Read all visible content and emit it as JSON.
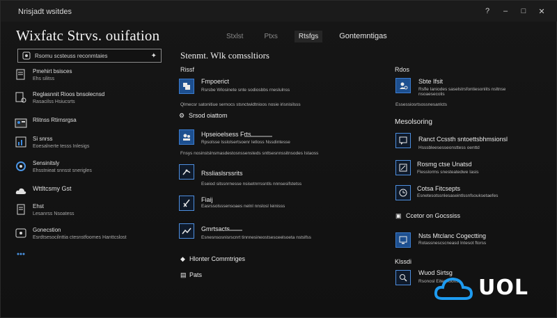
{
  "window": {
    "app_title": "Nrisjadt wsitdes",
    "controls": [
      "?",
      "–",
      "□",
      "✕"
    ]
  },
  "page_title": "Wixfatc Strvs. ouifation",
  "tabs": [
    {
      "label": "Stxlst",
      "state": "normal"
    },
    {
      "label": "Ptxs",
      "state": "normal"
    },
    {
      "label": "Rtsfgs",
      "state": "active"
    },
    {
      "label": "Gontemntigas",
      "state": "emph"
    }
  ],
  "search": {
    "value": "Rsomu scsteuss reconmtaies"
  },
  "sidebar": [
    {
      "icon": "document-icon",
      "title": "Pmehirt bsisces",
      "sub": "Ehs silitss"
    },
    {
      "icon": "doc-settings-icon",
      "title": "Reglasnnit Rioos bnsolecnsd",
      "sub": "Rasacilss Hsiucsrts"
    },
    {
      "icon": "person-card-icon",
      "title": "Rlitnss Rtirnsrgsa",
      "sub": ""
    },
    {
      "icon": "chart-doc-icon",
      "title": "Si snrss",
      "sub": "Eoesalnerte tesss Inlesigs"
    },
    {
      "icon": "refresh-icon",
      "title": "Sensinitsly",
      "sub": "Ehsstnieat snnsst snerigles"
    },
    {
      "icon": "cloud-icon",
      "title": "Wttltcsmy Gst",
      "sub": ""
    },
    {
      "icon": "list-icon",
      "title": "Ehst",
      "sub": "Lesanrss Nsoatess"
    },
    {
      "icon": "info-icon",
      "title": "Gonecstion",
      "sub": "Esrdtsesocilnttia ctesnstfoomes Hanttcslost"
    },
    {
      "icon": "dots-icon",
      "title": "",
      "sub": ""
    }
  ],
  "center": {
    "title": "Stenmt. Wlk comssltiors",
    "section_head": "Rissf",
    "items": [
      {
        "icon": "puzzle-icon",
        "title": "Fmpoerict",
        "desc": "Rsrsbe Wlosinete snte sodiosbbs rneslulnss",
        "tile": "blue"
      },
      {
        "icon": "",
        "title": "Qlmecsr satonitiue sernocs stsnctwidtnioos nosie irisnisilsss",
        "desc": "",
        "tile": "none"
      },
      {
        "icon": "link-icon",
        "title": "Srsod oiattom",
        "desc": "",
        "tile": "none"
      },
      {
        "icon": "people-icon",
        "title": "Hpseioelsess Frts",
        "desc": "Rpsolsse lsslolsertsoenr Ietloss Nssdintesse",
        "tile": "blue"
      },
      {
        "icon": "",
        "title": "Fnsys nosinstslnsmasdestosnssensteds snttsesnnssitnsodes Istaoss",
        "desc": "",
        "tile": "none"
      },
      {
        "icon": "share-icon",
        "title": "Rssliaslsrssrits",
        "desc": "Eseiod sitssnrnesse nsisetnrrssntls nnnsesifstetss",
        "tile": "outline"
      },
      {
        "icon": "tools-icon",
        "title": "Fiaij",
        "desc": "Easrssolsssensoaes nelnl nnslosl Ieinisss",
        "tile": "outline"
      },
      {
        "icon": "trend-icon",
        "title": "Gmrtsacts",
        "desc": "Esnesnsosnisrscnrt tinnnesineostsesceelsoeta nstslfss",
        "tile": "outline"
      },
      {
        "icon": "diamond-icon",
        "title": "Hlonter Commtriges",
        "desc": "",
        "tile": "bare"
      },
      {
        "icon": "doc-icon",
        "title": "Pats",
        "desc": "",
        "tile": "bare"
      }
    ]
  },
  "right": {
    "section_head": "Rdos",
    "items": [
      {
        "icon": "person-settings-icon",
        "title": "Sbte Ifsit",
        "desc": "Rsfle Ianiodes saselstrsfontiesonlits nsltnse nsoaesecolis",
        "tile": "blue"
      },
      {
        "icon": "",
        "title": "Essessiosrtsossnesanlcts",
        "desc": "",
        "tile": "none"
      },
      {
        "icon": "",
        "title": "Mesolsoring",
        "desc": "",
        "tile": "head"
      },
      {
        "icon": "chat-icon",
        "title": "Ranct Ccssth sntoettsbhmsionsl",
        "desc": "Hsssbleesesseonsttess oenttd",
        "tile": "outline"
      },
      {
        "icon": "chat-edit-icon",
        "title": "Rosmg ctse Unatsd",
        "desc": "Flesslorms snesteatedwe Iasis",
        "tile": "outline"
      },
      {
        "icon": "time-icon",
        "title": "Cotsa Fitcsepts",
        "desc": "Esnetesotssnlesaseintlssnfsouksetaefes",
        "tile": "outline"
      },
      {
        "icon": "screen-icon",
        "title": "Ccetor on Gocssiss",
        "desc": "",
        "tile": "dark"
      },
      {
        "icon": "monitor-icon",
        "title": "Nsts Mtclanc Cogectting",
        "desc": "Rotassnescscneasd Intesot ftorss",
        "tile": "blue"
      },
      {
        "icon": "",
        "title": "Klssdi",
        "desc": "",
        "tile": "head"
      },
      {
        "icon": "search-doc-icon",
        "title": "Wuod Sirtsg",
        "desc": "Rsonosl Eitesnoonss",
        "tile": "outline"
      }
    ]
  },
  "watermark": {
    "text": "UOL",
    "color": "#1e9bf0"
  }
}
